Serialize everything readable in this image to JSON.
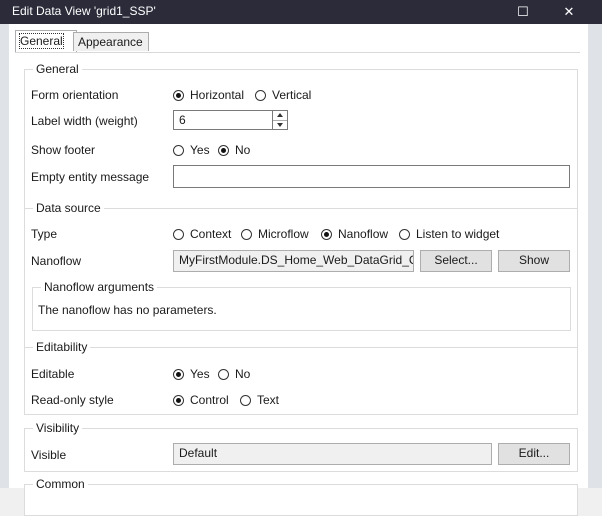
{
  "window": {
    "title": "Edit Data View 'grid1_SSP'",
    "maximize_icon": "☐",
    "close_icon": "✕"
  },
  "tabs": [
    "General",
    "Appearance"
  ],
  "general": {
    "title": "General",
    "form_orientation": {
      "label": "Form orientation",
      "options": [
        "Horizontal",
        "Vertical"
      ],
      "selected": "Horizontal"
    },
    "label_width": {
      "label": "Label width (weight)",
      "value": "6"
    },
    "show_footer": {
      "label": "Show footer",
      "options": [
        "Yes",
        "No"
      ],
      "selected": "No"
    },
    "empty_entity_message": {
      "label": "Empty entity message",
      "value": ""
    }
  },
  "data_source": {
    "title": "Data source",
    "type": {
      "label": "Type",
      "options": [
        "Context",
        "Microflow",
        "Nanoflow",
        "Listen to widget"
      ],
      "selected": "Nanoflow"
    },
    "nanoflow": {
      "label": "Nanoflow",
      "value": "MyFirstModule.DS_Home_Web_DataGrid_Cre",
      "select_label": "Select...",
      "show_label": "Show"
    },
    "arguments": {
      "title": "Nanoflow arguments",
      "text": "The nanoflow has no parameters."
    }
  },
  "editability": {
    "title": "Editability",
    "editable": {
      "label": "Editable",
      "options": [
        "Yes",
        "No"
      ],
      "selected": "Yes"
    },
    "read_only_style": {
      "label": "Read-only style",
      "options": [
        "Control",
        "Text"
      ],
      "selected": "Control"
    }
  },
  "visibility": {
    "title": "Visibility",
    "visible": {
      "label": "Visible",
      "value": "Default",
      "edit_label": "Edit..."
    }
  },
  "common": {
    "title": "Common"
  }
}
